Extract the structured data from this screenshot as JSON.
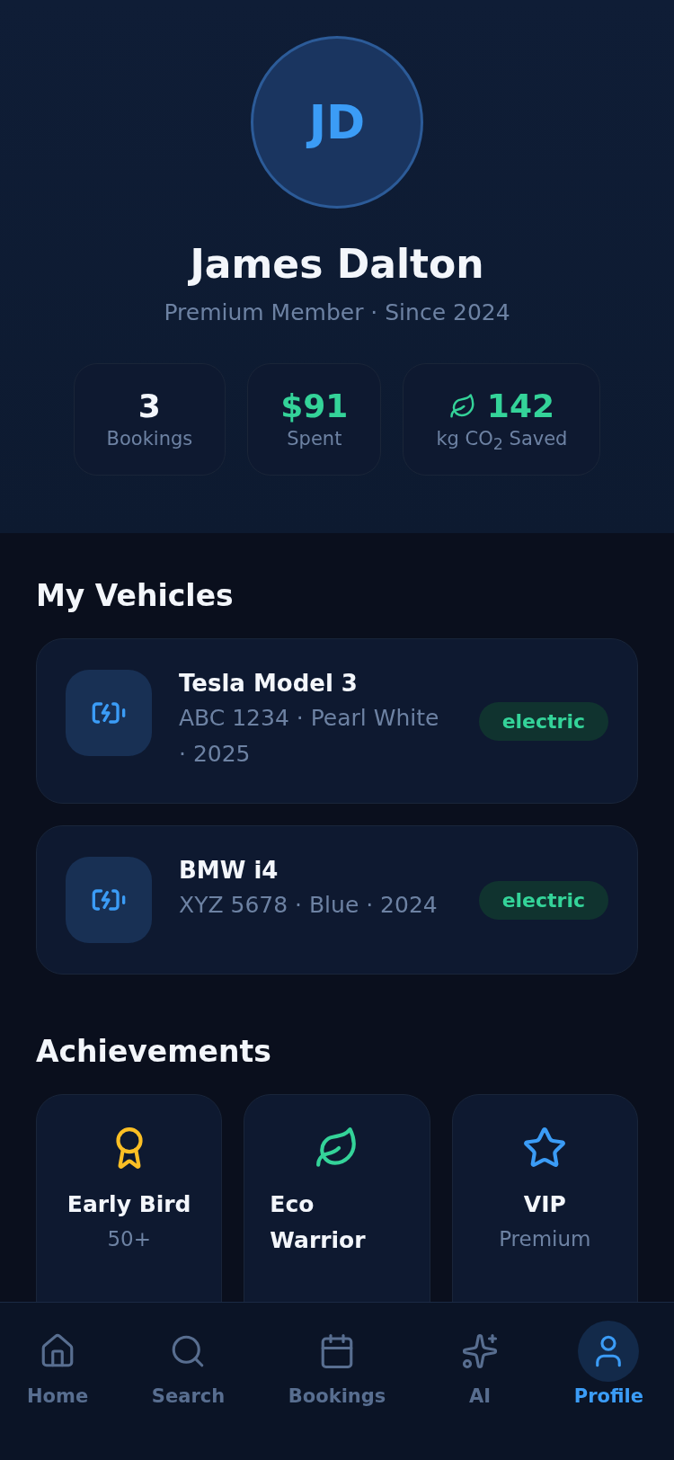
{
  "profile": {
    "initials": "JD",
    "name": "James Dalton",
    "subtitle": "Premium Member · Since 2024"
  },
  "stats": [
    {
      "kind": "count",
      "value": "3",
      "label": "Bookings"
    },
    {
      "kind": "money",
      "value": "$91",
      "label": "Spent"
    },
    {
      "kind": "eco",
      "value": "142",
      "label": "kg CO$_{2}$ Saved"
    }
  ],
  "vehicles_section": {
    "title": "My Vehicles"
  },
  "vehicles": [
    {
      "name": "Tesla Model 3",
      "details": "ABC 1234 · Pearl White · 2025",
      "badge": "electric"
    },
    {
      "name": "BMW i4",
      "details": "XYZ 5678 · Blue · 2024",
      "badge": "electric"
    }
  ],
  "achievements_section": {
    "title": "Achievements"
  },
  "achievements": [
    {
      "title": "Early Bird",
      "description": "50+",
      "color": "#fbbf24"
    },
    {
      "title": "Eco Warrior",
      "color": "#34d399"
    },
    {
      "title": "VIP",
      "description": "Premium",
      "color": "#3b9cf6"
    }
  ],
  "nav": [
    {
      "label": "Home",
      "selected": false
    },
    {
      "label": "Search",
      "selected": false
    },
    {
      "label": "Bookings",
      "selected": false
    },
    {
      "label": "AI",
      "selected": false
    },
    {
      "label": "Profile",
      "selected": true
    }
  ]
}
